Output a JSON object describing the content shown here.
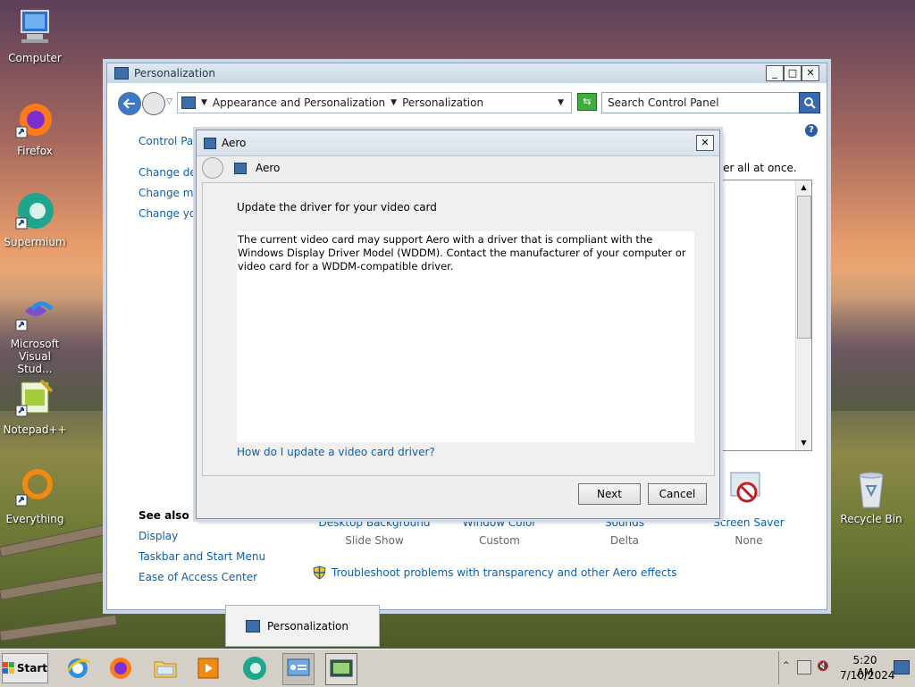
{
  "desktop": {
    "icons": [
      {
        "label": "Computer"
      },
      {
        "label": "Firefox"
      },
      {
        "label": "Supermium"
      },
      {
        "label": "Microsoft Visual Stud..."
      },
      {
        "label": "Notepad++"
      },
      {
        "label": "Everything"
      },
      {
        "label": "Recycle Bin"
      }
    ]
  },
  "window": {
    "title": "Personalization",
    "minimize": "_",
    "maximize": "□",
    "close": "✕",
    "breadcrumb": [
      "Appearance and Personalization",
      "Personalization"
    ],
    "search_placeholder": "Search Control Panel",
    "sidebar": {
      "control_panel_link": "Control Pan",
      "links": [
        "Change des",
        "Change mo",
        "Change you"
      ],
      "see_also_heading": "See also",
      "see_also": [
        "Display",
        "Taskbar and Start Menu",
        "Ease of Access Center"
      ]
    },
    "main_text_fragment": "ver all at once.",
    "bottom_items": [
      {
        "label": "Desktop Background",
        "value": "Slide Show"
      },
      {
        "label": "Window Color",
        "value": "Custom"
      },
      {
        "label": "Sounds",
        "value": "Delta"
      },
      {
        "label": "Screen Saver",
        "value": "None"
      }
    ],
    "troubleshoot_link": "Troubleshoot problems with transparency and other Aero effects"
  },
  "dialog": {
    "title": "Aero",
    "nav_label": "Aero",
    "close": "✕",
    "heading": "Update the driver for your video card",
    "message": "The current video card may support Aero with a driver that is compliant with the Windows Display Driver Model (WDDM).  Contact the manufacturer of your computer or video card for a WDDM-compatible driver.",
    "help_link": "How do I update a video card driver?",
    "next_label": "Next",
    "cancel_label": "Cancel"
  },
  "tooltip": {
    "label": "Personalization"
  },
  "taskbar": {
    "start_label": "Start",
    "time": "5:20 AM",
    "date": "7/10/2024"
  }
}
